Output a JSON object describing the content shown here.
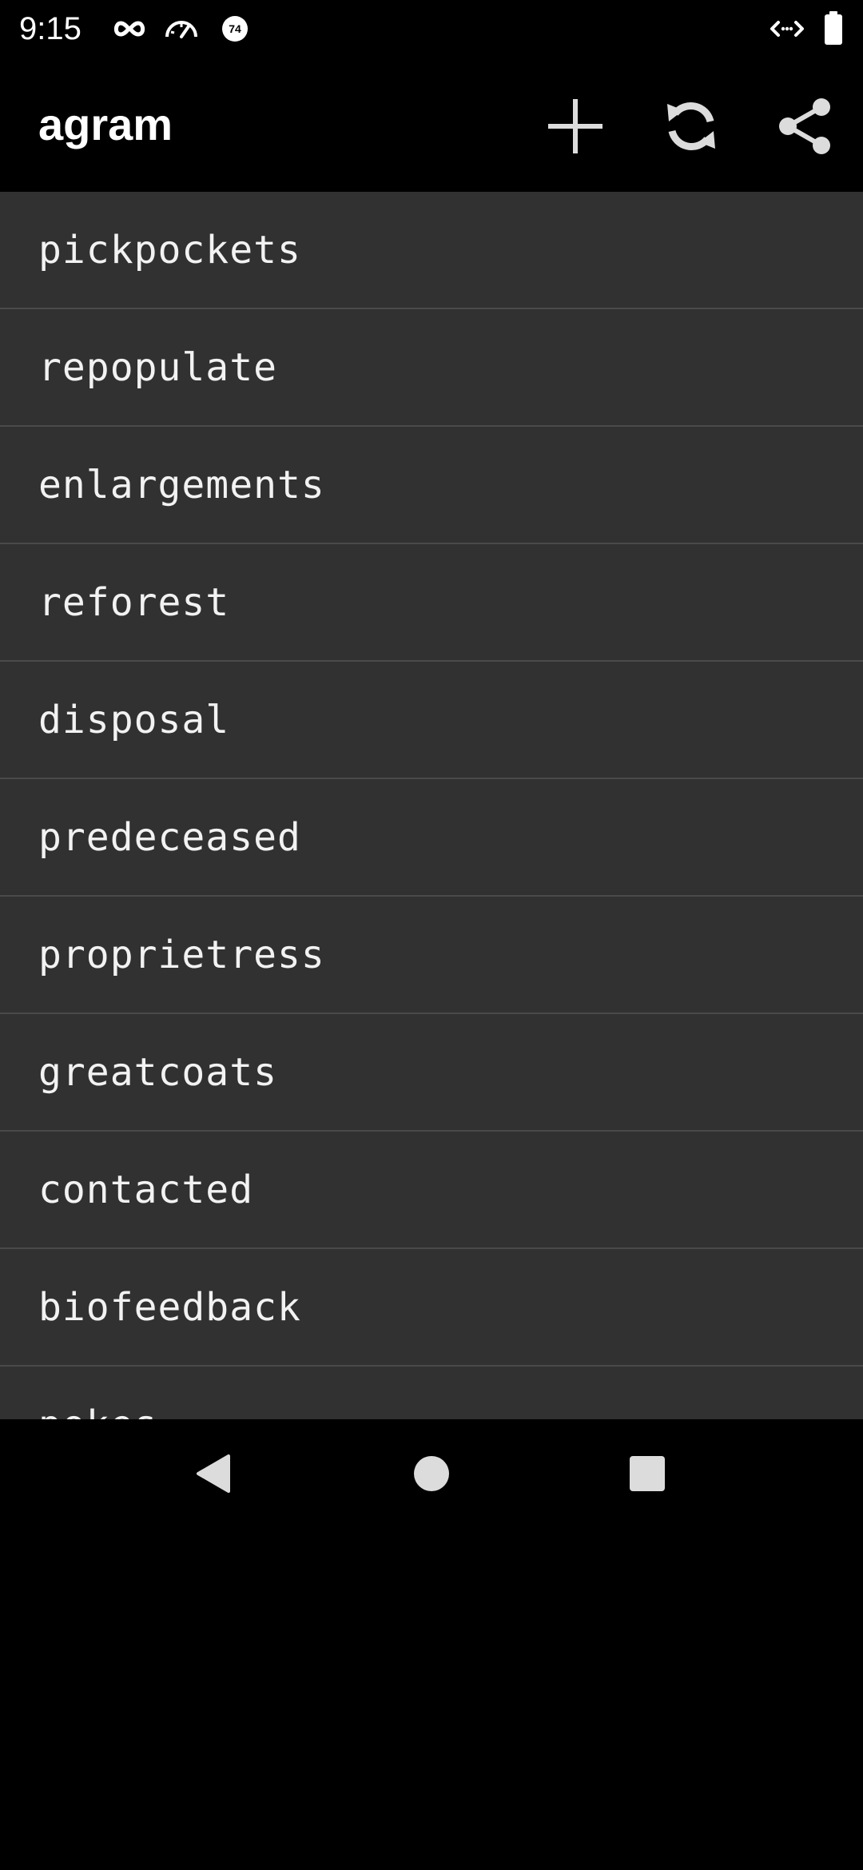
{
  "status_bar": {
    "time": "9:15",
    "icons_left": [
      "infinity-icon",
      "speedometer-icon",
      "badge-74-icon"
    ],
    "badge_text": "74",
    "icons_right": [
      "code-arrows-icon",
      "battery-icon"
    ]
  },
  "app_bar": {
    "title": "agram",
    "actions": [
      "add-icon",
      "refresh-icon",
      "share-icon"
    ]
  },
  "words": [
    "pickpockets",
    "repopulate",
    "enlargements",
    "reforest",
    "disposal",
    "predeceased",
    "proprietress",
    "greatcoats",
    "contacted",
    "biofeedback",
    "pokes"
  ],
  "nav_bar": {
    "buttons": [
      "back-icon",
      "home-icon",
      "recents-icon"
    ]
  },
  "colors": {
    "background": "#000000",
    "list_background": "#313131",
    "divider": "#4a4a4a",
    "text": "#f2f2f2",
    "icon": "#dcdcdc"
  }
}
